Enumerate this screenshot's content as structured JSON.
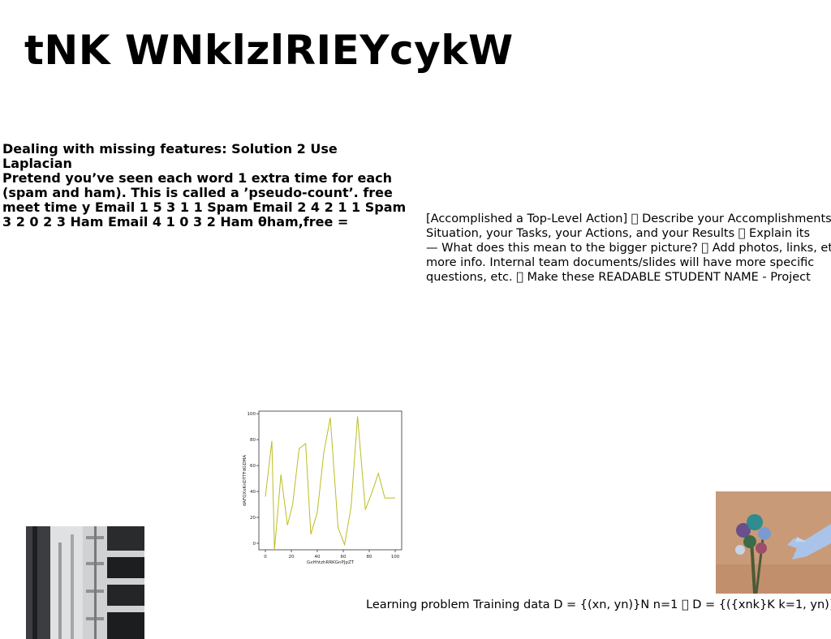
{
  "title": "tNK WNklzlRIEYcykW",
  "left_block": {
    "lines": [
      "Dealing with missing features: Solution 2 Use Laplacian",
      "Pretend you’ve seen each word 1 extra time for each",
      "(spam and ham). This is called a ’pseudo-count’. free",
      "meet time y Email 1 5 3 1 1 Spam Email 2 4 2 1 1 Spam",
      "3 2 0 2 3 Ham Email 4 1 0 3 2 Ham θham,free ="
    ]
  },
  "right_block": {
    "lines": [
      "[Accomplished a Top-Level Action] \u0000 Describe your Accomplishments!",
      "Situation, your Tasks, your Actions, and your Results \u0000 Explain its",
      "— What does this mean to the bigger picture? \u0000 Add photos, links, etc",
      "more info. Internal team documents/slides will have more specific",
      "questions, etc. \u0000 Make these READABLE STUDENT NAME - Project"
    ]
  },
  "bottom_text": "Learning problem Training data D = {(xn, yn)}N n=1 \u0000 D = {({xnk}K k=1, yn)}N n=1",
  "chart_data": {
    "type": "line",
    "xlabel": "GxHhtzhRRKGnPJpZT",
    "ylabel": "dAFQXxKnDTTFdGDMA",
    "xlim": [
      -5,
      105
    ],
    "ylim": [
      -5,
      102
    ],
    "xticks": [
      0,
      20,
      40,
      60,
      80,
      100
    ],
    "yticks": [
      0,
      20,
      40,
      60,
      80,
      100
    ],
    "grid": false,
    "series": [
      {
        "color": "#bcbd22",
        "x": [
          0,
          5,
          7,
          12,
          17,
          21,
          26,
          31,
          35,
          40,
          45,
          50,
          56,
          61,
          66,
          71,
          77,
          82,
          87,
          92,
          97,
          100
        ],
        "y": [
          36,
          79,
          -5,
          53,
          14,
          30,
          73,
          77,
          7,
          24,
          70,
          97,
          12,
          -1,
          28,
          98,
          26,
          39,
          54,
          35,
          35,
          35
        ]
      }
    ]
  },
  "images": {
    "building": "building-photo",
    "flowers": "bouquet-and-hand-photo"
  }
}
